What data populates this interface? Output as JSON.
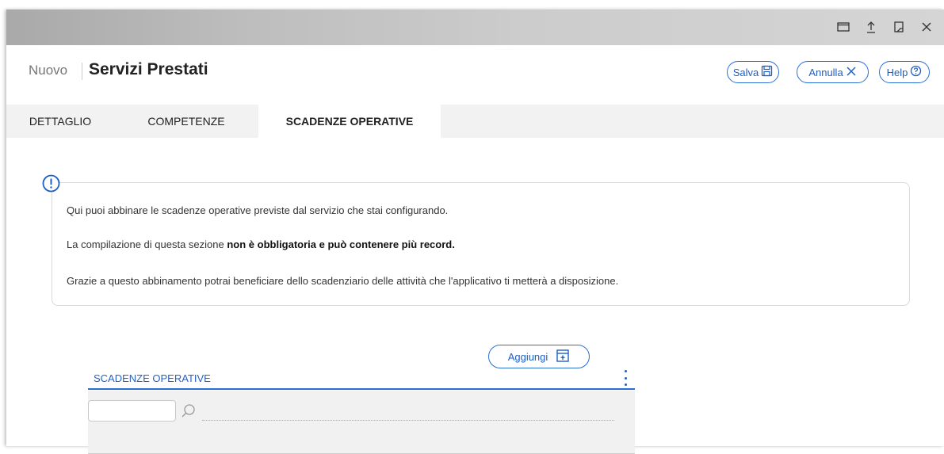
{
  "window": {
    "controls": [
      "restore-icon",
      "upload-icon",
      "bookmark-icon",
      "close-icon"
    ]
  },
  "header": {
    "mode": "Nuovo",
    "title": "Servizi Prestati",
    "buttons": {
      "save": "Salva",
      "cancel": "Annulla",
      "help": "Help"
    }
  },
  "tabs": [
    {
      "label": "DETTAGLIO",
      "active": false
    },
    {
      "label": "COMPETENZE",
      "active": false
    },
    {
      "label": "SCADENZE OPERATIVE",
      "active": true
    }
  ],
  "info": {
    "line1": "Qui puoi abbinare le scadenze operative previste dal servizio che stai configurando.",
    "line2_prefix": "La compilazione di questa sezione ",
    "line2_bold": "non è obbligatoria e può contenere più record.",
    "line3": "Grazie a questo abbinamento potrai beneficiare dello scadenziario delle attività che l'applicativo ti metterà a disposizione."
  },
  "grid": {
    "add_label": "Aggiungi",
    "title": "SCADENZE OPERATIVE",
    "filter_value": ""
  },
  "colors": {
    "accent": "#2a6fd6",
    "accent_text": "#1f5fc4",
    "tab_bg": "#f2f2f2"
  }
}
